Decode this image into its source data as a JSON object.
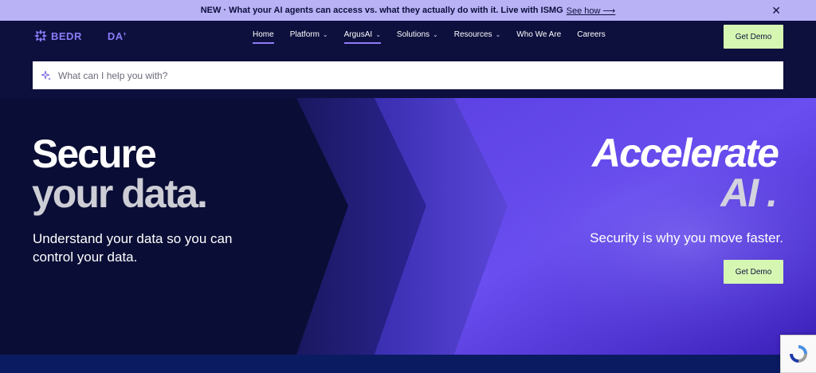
{
  "announcement": {
    "text": "NEW · What your AI agents can access vs. what they actually do with it. Live with ISMG",
    "link": "See how ⟶",
    "close": "✕"
  },
  "header": {
    "logo_text_1": "BEDR",
    "logo_text_2": "DA",
    "nav": [
      {
        "label": "Home",
        "active": true,
        "dropdown": false
      },
      {
        "label": "Platform",
        "active": false,
        "dropdown": true
      },
      {
        "label": "ArgusAI",
        "active": true,
        "dropdown": true
      },
      {
        "label": "Solutions",
        "active": false,
        "dropdown": true
      },
      {
        "label": "Resources",
        "active": false,
        "dropdown": true
      },
      {
        "label": "Who We Are",
        "active": false,
        "dropdown": false
      },
      {
        "label": "Careers",
        "active": false,
        "dropdown": false
      }
    ],
    "cta": "Get Demo",
    "chevron": "⌄"
  },
  "search": {
    "placeholder": "What can I help you with?"
  },
  "hero": {
    "left_title_1": "Secure",
    "left_title_2": "your data.",
    "left_subtitle": "Understand your data so you can control your data.",
    "right_title_1": "Accelerate",
    "right_title_2": "AI .",
    "right_subtitle": "Security is why you move faster.",
    "cta": "Get Demo"
  },
  "colors": {
    "navy": "#0d0f3d",
    "lavender": "#b9b2f5",
    "accent_purple": "#8f7cf6",
    "cta_green": "#d6f7b2"
  }
}
